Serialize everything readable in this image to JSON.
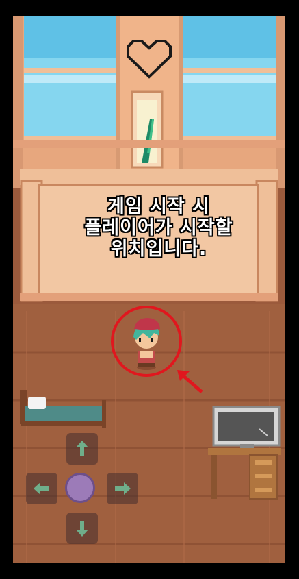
{
  "scene": {
    "caption_lines": [
      "게임 시작 시",
      "플레이어가 시작할",
      "위치입니다."
    ]
  },
  "dpad": {
    "up": "arrow-up-icon",
    "down": "arrow-down-icon",
    "left": "arrow-left-icon",
    "right": "arrow-right-icon"
  },
  "colors": {
    "highlight": "#e0171e",
    "floor": "#9b5a3c",
    "sky": "#7fd3ee",
    "wall_trim": "#f2b48a",
    "dpad_center": "#9c7bb8"
  }
}
